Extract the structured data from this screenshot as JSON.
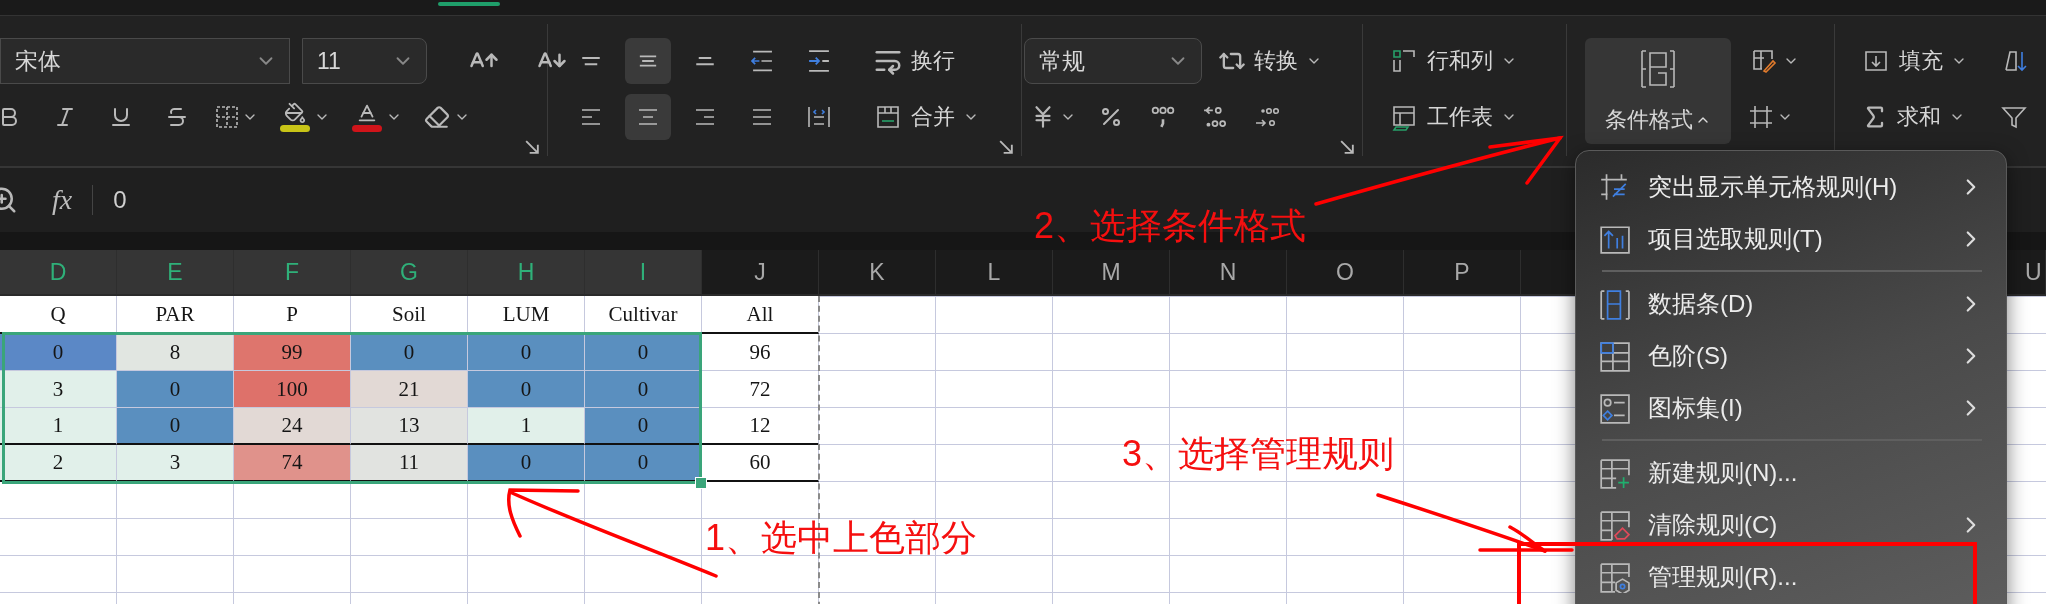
{
  "ribbon": {
    "font": {
      "name": "宋体",
      "size": "11"
    },
    "alignment": {
      "vertical": [
        {
          "selected": false
        },
        {
          "selected": true
        },
        {
          "selected": false
        }
      ],
      "horizontal": [
        {
          "selected": false
        },
        {
          "selected": true
        },
        {
          "selected": false
        },
        {
          "selected": false
        }
      ],
      "wrap_label": "换行",
      "merge_label": "合并"
    },
    "number": {
      "format": "常规",
      "convert_label": "转换"
    },
    "cells": {
      "rows_columns_label": "行和列",
      "worksheet_label": "工作表"
    },
    "conditional_format": {
      "label": "条件格式",
      "expanded": true
    },
    "editing": {
      "fill_label": "填充",
      "sum_label": "求和"
    }
  },
  "formula_bar": {
    "function_label": "fx",
    "value": "0"
  },
  "sheet": {
    "columns": [
      {
        "label": "D",
        "selected": true,
        "page_break_after": false
      },
      {
        "label": "E",
        "selected": true,
        "page_break_after": false
      },
      {
        "label": "F",
        "selected": true,
        "page_break_after": false
      },
      {
        "label": "G",
        "selected": true,
        "page_break_after": false
      },
      {
        "label": "H",
        "selected": true,
        "page_break_after": false
      },
      {
        "label": "I",
        "selected": true,
        "page_break_after": false
      },
      {
        "label": "J",
        "selected": false,
        "page_break_after": true
      },
      {
        "label": "K",
        "selected": false,
        "page_break_after": false
      },
      {
        "label": "L",
        "selected": false,
        "page_break_after": false
      },
      {
        "label": "M",
        "selected": false,
        "page_break_after": false
      },
      {
        "label": "N",
        "selected": false,
        "page_break_after": false
      },
      {
        "label": "O",
        "selected": false,
        "page_break_after": false
      },
      {
        "label": "P",
        "selected": false,
        "page_break_after": false
      },
      {
        "label": "U",
        "selected": false,
        "page_break_after": false
      }
    ],
    "rows": [
      {
        "selected": false,
        "rule_below": true,
        "cells": [
          {
            "text": "Q"
          },
          {
            "text": "PAR"
          },
          {
            "text": "P"
          },
          {
            "text": "Soil"
          },
          {
            "text": "LUM"
          },
          {
            "text": "Cultivar"
          },
          {
            "text": "All"
          }
        ]
      },
      {
        "selected": true,
        "rule_below": false,
        "cells": [
          {
            "text": "0",
            "color": "#5b88c6"
          },
          {
            "text": "8",
            "color": "#e1e6e1"
          },
          {
            "text": "99",
            "color": "#de756d"
          },
          {
            "text": "0",
            "color": "#5a8fbf"
          },
          {
            "text": "0",
            "color": "#5a8fbf"
          },
          {
            "text": "0",
            "color": "#5a8fbf"
          },
          {
            "text": "96"
          }
        ]
      },
      {
        "selected": true,
        "rule_below": false,
        "cells": [
          {
            "text": "3",
            "color": "#e1f0ea"
          },
          {
            "text": "0",
            "color": "#5a8fbf"
          },
          {
            "text": "100",
            "color": "#de716a"
          },
          {
            "text": "21",
            "color": "#e2d9d5"
          },
          {
            "text": "0",
            "color": "#5a8fbf"
          },
          {
            "text": "0",
            "color": "#5a8fbf"
          },
          {
            "text": "72"
          }
        ]
      },
      {
        "selected": true,
        "rule_below": true,
        "cells": [
          {
            "text": "1",
            "color": "#e1f0ea"
          },
          {
            "text": "0",
            "color": "#5a8fbf"
          },
          {
            "text": "24",
            "color": "#e2d9d5"
          },
          {
            "text": "13",
            "color": "#e1e3e0"
          },
          {
            "text": "1",
            "color": "#e1f0ea"
          },
          {
            "text": "0",
            "color": "#5a8fbf"
          },
          {
            "text": "12"
          }
        ]
      },
      {
        "selected": true,
        "rule_below": true,
        "cells": [
          {
            "text": "2",
            "color": "#e1f0ea"
          },
          {
            "text": "3",
            "color": "#e1f0ea"
          },
          {
            "text": "74",
            "color": "#e0928b"
          },
          {
            "text": "11",
            "color": "#e1e3e0"
          },
          {
            "text": "0",
            "color": "#5a8fbf"
          },
          {
            "text": "0",
            "color": "#5a8fbf"
          },
          {
            "text": "60"
          }
        ]
      }
    ]
  },
  "context_menu": {
    "sections": [
      {
        "items": [
          {
            "label": "突出显示单元格规则(H)",
            "submenu": true
          },
          {
            "label": "项目选取规则(T)",
            "submenu": true
          }
        ]
      },
      {
        "items": [
          {
            "label": "数据条(D)",
            "submenu": true
          },
          {
            "label": "色阶(S)",
            "submenu": true
          },
          {
            "label": "图标集(I)",
            "submenu": true
          }
        ]
      },
      {
        "items": [
          {
            "label": "新建规则(N)...",
            "submenu": false
          },
          {
            "label": "清除规则(C)",
            "submenu": true
          },
          {
            "label": "管理规则(R)...",
            "submenu": false
          }
        ]
      }
    ]
  },
  "annotations": [
    {
      "text": "1、选中上色部分"
    },
    {
      "text": "2、选择条件格式"
    },
    {
      "text": "3、选择管理规则"
    }
  ]
}
